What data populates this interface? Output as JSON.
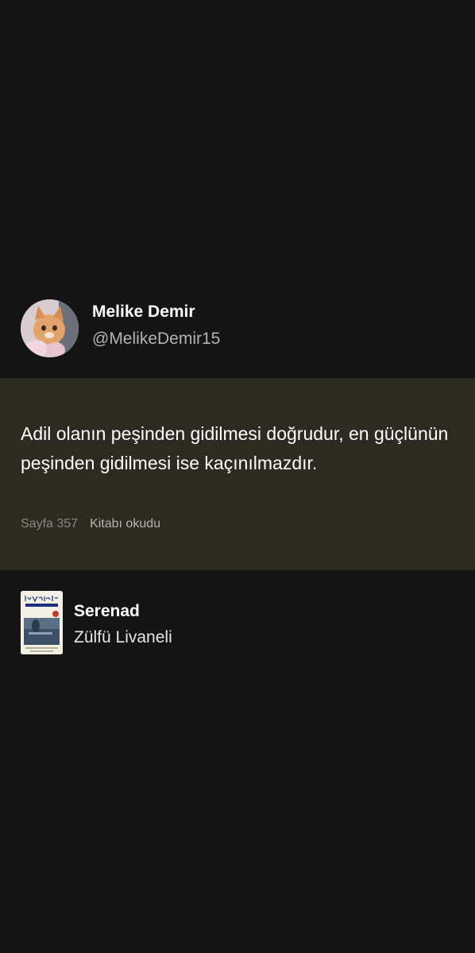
{
  "author": {
    "name": "Melike Demir",
    "handle": "@MelikeDemir15",
    "avatar_icon": "profile-photo-cat"
  },
  "quote": {
    "text": "Adil olanın peşinden gidilmesi doğrudur, en güçlünün peşinden gidilmesi ise kaçınılmazdır.",
    "page_ref": "Sayfa 357",
    "status": "Kitabı okudu"
  },
  "book": {
    "title": "Serenad",
    "author": "Zülfü Livaneli",
    "cover_icon": "book-cover-image"
  },
  "colors": {
    "background": "#141414",
    "quote_card": "#2d2a20",
    "secondary_text": "#b3b3b3"
  }
}
